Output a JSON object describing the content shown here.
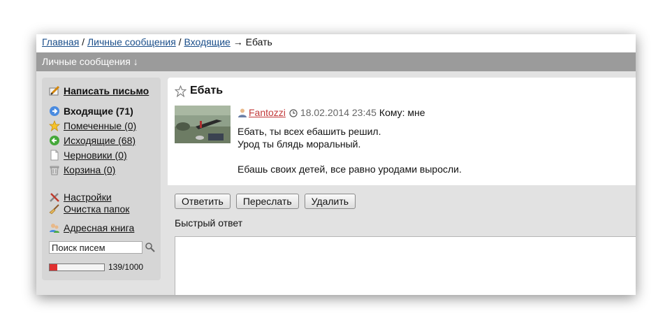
{
  "breadcrumb": {
    "home": "Главная",
    "sep1": " / ",
    "messages": "Личные сообщения",
    "sep2": " / ",
    "inbox": "Входящие",
    "arrow": " → ",
    "current": "Ебать"
  },
  "titlebar": {
    "label": "Личные сообщения ↓"
  },
  "sidebar": {
    "compose": "Написать письмо",
    "folders": [
      {
        "label": "Входящие (71)",
        "icon": "inbox-arrow-icon"
      },
      {
        "label": "Помеченные (0)",
        "icon": "star-icon"
      },
      {
        "label": "Исходящие (68)",
        "icon": "outbox-arrow-icon"
      },
      {
        "label": "Черновики (0)",
        "icon": "document-icon"
      },
      {
        "label": "Корзина (0)",
        "icon": "trash-icon"
      }
    ],
    "settings": "Настройки",
    "clean": "Очистка папок",
    "addressbook": "Адресная книга",
    "search_value": "Поиск писем",
    "quota_text": "139/1000",
    "quota_fraction": 0.139
  },
  "message": {
    "subject": "Ебать",
    "author": "Fantozzi",
    "date": "18.02.2014 23:45",
    "to": "Кому: мне",
    "lines": [
      "Ебать, ты всех ебашить решил.",
      "Урод ты блядь моральный.",
      "",
      "Ебашь своих детей, все равно уродами выросли."
    ]
  },
  "actions": {
    "reply": "Ответить",
    "forward": "Переслать",
    "delete": "Удалить"
  },
  "quick_reply": {
    "label": "Быстрый ответ",
    "value": ""
  },
  "colors": {
    "titlebar": "#9b9b9b",
    "link": "#1a4e8a",
    "author": "#c23a3a",
    "quota_fill": "#e03030"
  }
}
